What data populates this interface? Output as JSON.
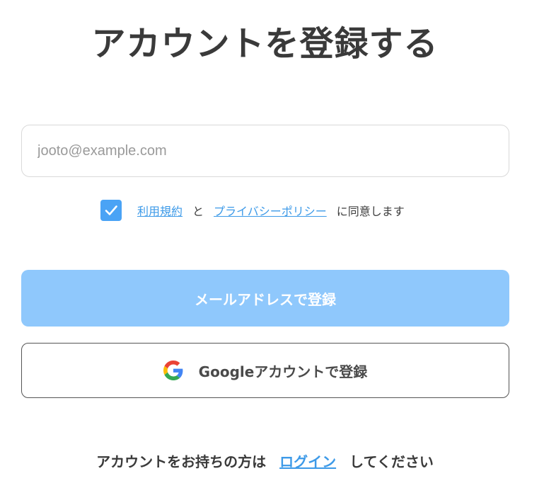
{
  "page": {
    "title": "アカウントを登録する"
  },
  "email": {
    "placeholder": "jooto@example.com",
    "value": ""
  },
  "agreement": {
    "checked": true,
    "terms_link": "利用規約",
    "and_text": "と",
    "privacy_link": "プライバシーポリシー",
    "suffix_text": "に同意します"
  },
  "buttons": {
    "email_register": "メールアドレスで登録",
    "google_register": "Googleアカウントで登録"
  },
  "footer": {
    "prefix_text": "アカウントをお持ちの方は",
    "login_link": "ログイン",
    "suffix_text": "してください"
  },
  "colors": {
    "accent": "#4aa3f5",
    "link": "#3d9ae8",
    "primary_button_bg": "#8fc8fc",
    "border": "#d9d9d9"
  },
  "icons": {
    "checkbox": "check-icon",
    "google": "google-logo-icon"
  }
}
